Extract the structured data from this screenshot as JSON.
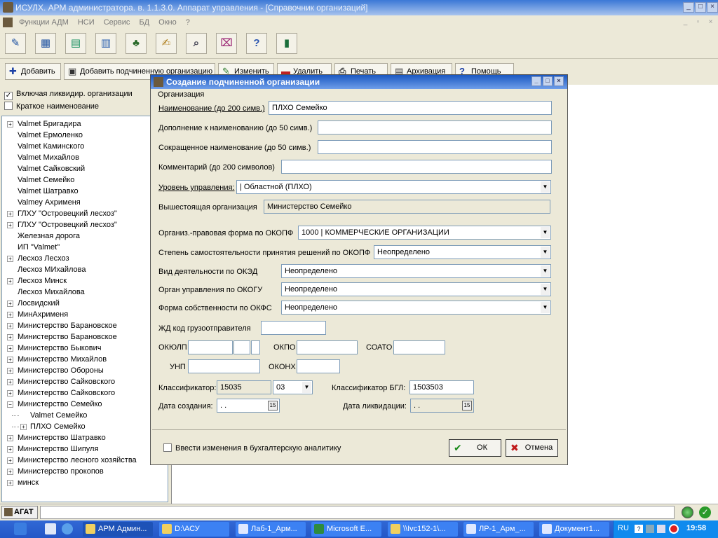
{
  "app": {
    "title": "ИСУЛХ. АРМ администратора. в. 1.1.3.0. Аппарат управления - [Справочник организаций]"
  },
  "menu": [
    "Функции АДМ",
    "НСИ",
    "Сервис",
    "БД",
    "Окно",
    "?"
  ],
  "toolbar_icons": [
    "edit-icon",
    "calculator-icon",
    "spreadsheet-icon",
    "grid-icon",
    "tree-icon",
    "notepad-icon",
    "search-icon",
    "cassette-icon",
    "help-icon",
    "door-icon"
  ],
  "toolbar2": {
    "add": "Добавить",
    "add_sub": "Добавить подчиненную организацию",
    "change": "Изменить",
    "delete": "Удалить",
    "print": "Печать",
    "archive": "Архивация",
    "help": "Помощь"
  },
  "left": {
    "include_liquidated": "Включая ликвидир. организации",
    "short_name": "Краткое наименование"
  },
  "tree": [
    {
      "label": "Valmet Бригадира",
      "exp": "+",
      "level": 0
    },
    {
      "label": "Valmet Ермоленко",
      "exp": "",
      "level": 0
    },
    {
      "label": "Valmet Каминского",
      "exp": "",
      "level": 0
    },
    {
      "label": "Valmet Михайлов",
      "exp": "",
      "level": 0
    },
    {
      "label": "Valmet Сайковский",
      "exp": "",
      "level": 0
    },
    {
      "label": "Valmet Семейко",
      "exp": "",
      "level": 0
    },
    {
      "label": "Valmet Шатравко",
      "exp": "",
      "level": 0
    },
    {
      "label": "Valmey Ахрименя",
      "exp": "",
      "level": 0
    },
    {
      "label": "ГЛХУ \"Островецкий лесхоз\"",
      "exp": "+",
      "level": 0
    },
    {
      "label": "ГЛХУ \"Островецкий лесхоз\"",
      "exp": "+",
      "level": 0
    },
    {
      "label": "Железная дорога",
      "exp": "",
      "level": 0
    },
    {
      "label": "ИП \"Valmet\"",
      "exp": "",
      "level": 0
    },
    {
      "label": "Лесхоз Лесхоз",
      "exp": "+",
      "level": 0
    },
    {
      "label": "Лесхоз МИхайлова",
      "exp": "",
      "level": 0
    },
    {
      "label": "Лесхоз Минск",
      "exp": "+",
      "level": 0
    },
    {
      "label": "Лесхоз Михайлова",
      "exp": "",
      "level": 0
    },
    {
      "label": "Лосвидский",
      "exp": "+",
      "level": 0
    },
    {
      "label": "МинАхрименя",
      "exp": "+",
      "level": 0
    },
    {
      "label": "Министерство Барановское",
      "exp": "+",
      "level": 0
    },
    {
      "label": "Министерство Барановское",
      "exp": "+",
      "level": 0
    },
    {
      "label": "Министерство Быкович",
      "exp": "+",
      "level": 0
    },
    {
      "label": "Министерство Михайлов",
      "exp": "+",
      "level": 0
    },
    {
      "label": "Министерство Обороны",
      "exp": "+",
      "level": 0
    },
    {
      "label": "Министерство Сайковского",
      "exp": "+",
      "level": 0
    },
    {
      "label": "Министерство Сайковского",
      "exp": "+",
      "level": 0
    },
    {
      "label": "Министерство Семейко",
      "exp": "−",
      "level": 0
    },
    {
      "label": "Valmet Семейко",
      "exp": "",
      "level": 1
    },
    {
      "label": "ПЛХО Семейко",
      "exp": "+",
      "level": 1
    },
    {
      "label": "Министерство Шатравко",
      "exp": "+",
      "level": 0
    },
    {
      "label": "Министерство Шипуля",
      "exp": "+",
      "level": 0
    },
    {
      "label": "Министерство лесного хозяйства",
      "exp": "+",
      "level": 0
    },
    {
      "label": "Министерство прокопов",
      "exp": "+",
      "level": 0
    },
    {
      "label": "минск",
      "exp": "+",
      "level": 0
    }
  ],
  "dialog": {
    "title": "Создание подчиненной организации",
    "group": "Организация",
    "name_label": "Наименование (до 200 симв.)",
    "name_value": "ПЛХО Семейко",
    "addition_label": "Дополнение к наименованию (до 50 симв.)",
    "short_label": "Сокращенное наименование (до 50 симв.)",
    "comment_label": "Комментарий (до 200 символов)",
    "level_label": "Уровень управления:",
    "level_value": "| Областной (ПЛХО)",
    "parent_label": "Вышестоящая организация",
    "parent_value": "Министерство Семейко",
    "okopf_label": "Организ.-правовая форма по ОКОПФ",
    "okopf_value": "1000 |  КОММЕРЧЕСКИЕ ОРГАНИЗАЦИИ",
    "indep_label": "Степень самостоятельности принятия решений по ОКОПФ",
    "indep_value": "Неопределено",
    "oked_label": "Вид деятельности по ОКЭД",
    "oked_value": "Неопределено",
    "okogu_label": "Орган управления по ОКОГУ",
    "okogu_value": "Неопределено",
    "okfs_label": "Форма собственности по ОКФС",
    "okfs_value": "Неопределено",
    "rail_label": "ЖД код грузоотправителя",
    "okulp_label": "ОКЮЛП",
    "okpo_label": "ОКПО",
    "soato_label": "СОАТО",
    "unp_label": "УНП",
    "okonh_label": "ОКОНХ",
    "classifier_label": "Классификатор:",
    "classifier_value": "15035",
    "classifier_code": "03",
    "bgl_label": "Классификатор БГЛ:",
    "bgl_value": "1503503",
    "created_label": "Дата создания:",
    "created_value": " .  .",
    "liquidated_label": "Дата ликвидации:",
    "liquidated_value": " .  .",
    "calendar_label": "15",
    "accounting_label": "Ввести изменения  в бухгалтерскую аналитику",
    "ok": "ОК",
    "cancel": "Отмена"
  },
  "status": {
    "agat": "АГАТ"
  },
  "taskbar": {
    "items": [
      "АРМ Админ...",
      "D:\\АСУ",
      "Лаб-1_Арм...",
      "Microsoft E...",
      "\\\\Ivc152-1\\...",
      "ЛР-1_Арм_...",
      "Документ1..."
    ],
    "lang": "RU",
    "clock": "19:58"
  },
  "colors": {
    "titlebar": "#3b78d6",
    "dialog_title": "#1a58c2",
    "taskbar": "#2457c7",
    "tray": "#0f8aee"
  }
}
